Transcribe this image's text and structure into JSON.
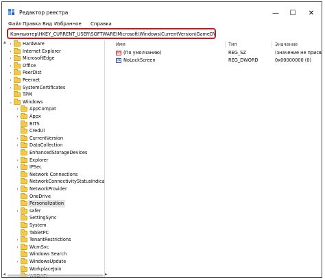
{
  "window": {
    "title": "Редактор реестра",
    "minimize": "—",
    "maximize": "☐",
    "close": "✕"
  },
  "menu": [
    "Файл",
    "Правка",
    "Вид",
    "Избранное",
    "Справка"
  ],
  "address": "Компьютер\\HKEY_CURRENT_USER\\SOFTWARE\\Microsoft\\Windows\\CurrentVersion\\GameDVR",
  "tree": [
    {
      "label": "Hardware",
      "level": 1,
      "chevron": "›"
    },
    {
      "label": "Internet Explorer",
      "level": 1,
      "chevron": "›"
    },
    {
      "label": "MicrosoftEdge",
      "level": 1,
      "chevron": "›"
    },
    {
      "label": "Office",
      "level": 1,
      "chevron": "›"
    },
    {
      "label": "PeerDist",
      "level": 1,
      "chevron": "›"
    },
    {
      "label": "Peernet",
      "level": 1,
      "chevron": "›"
    },
    {
      "label": "SystemCertificates",
      "level": 1,
      "chevron": "›"
    },
    {
      "label": "TPM",
      "level": 1,
      "chevron": ""
    },
    {
      "label": "Windows",
      "level": 1,
      "chevron": "⌄"
    },
    {
      "label": "AppCompat",
      "level": 2,
      "chevron": "›"
    },
    {
      "label": "Appx",
      "level": 2,
      "chevron": "›"
    },
    {
      "label": "BITS",
      "level": 2,
      "chevron": ""
    },
    {
      "label": "CredUI",
      "level": 2,
      "chevron": ""
    },
    {
      "label": "CurrentVersion",
      "level": 2,
      "chevron": "›"
    },
    {
      "label": "DataCollection",
      "level": 2,
      "chevron": "›"
    },
    {
      "label": "EnhancedStorageDevices",
      "level": 2,
      "chevron": ""
    },
    {
      "label": "Explorer",
      "level": 2,
      "chevron": "›"
    },
    {
      "label": "IPSec",
      "level": 2,
      "chevron": "›"
    },
    {
      "label": "Network Connections",
      "level": 2,
      "chevron": ""
    },
    {
      "label": "NetworkConnectivityStatusIndicator",
      "level": 2,
      "chevron": ""
    },
    {
      "label": "NetworkProvider",
      "level": 2,
      "chevron": "›"
    },
    {
      "label": "OneDrive",
      "level": 2,
      "chevron": ""
    },
    {
      "label": "Personalization",
      "level": 2,
      "chevron": "",
      "selected": true
    },
    {
      "label": "safer",
      "level": 2,
      "chevron": "›"
    },
    {
      "label": "SettingSync",
      "level": 2,
      "chevron": ""
    },
    {
      "label": "System",
      "level": 2,
      "chevron": ""
    },
    {
      "label": "TabletPC",
      "level": 2,
      "chevron": ""
    },
    {
      "label": "TenantRestrictions",
      "level": 2,
      "chevron": "›"
    },
    {
      "label": "WcmSvc",
      "level": 2,
      "chevron": "›"
    },
    {
      "label": "Windows Search",
      "level": 2,
      "chevron": ""
    },
    {
      "label": "WindowsUpdate",
      "level": 2,
      "chevron": "›"
    },
    {
      "label": "WorkplaceJoin",
      "level": 2,
      "chevron": ""
    },
    {
      "label": "WSDAPI",
      "level": 2,
      "chevron": ""
    }
  ],
  "list": {
    "columns": [
      "Имя",
      "Тип",
      "Значение"
    ],
    "rows": [
      {
        "name": "(По умолчанию)",
        "type": "REG_SZ",
        "value": "(значение не присвоено)",
        "icon": "ab"
      },
      {
        "name": "NoLockScreen",
        "type": "REG_DWORD",
        "value": "0x00000000 (0)",
        "icon": "bin"
      }
    ]
  }
}
